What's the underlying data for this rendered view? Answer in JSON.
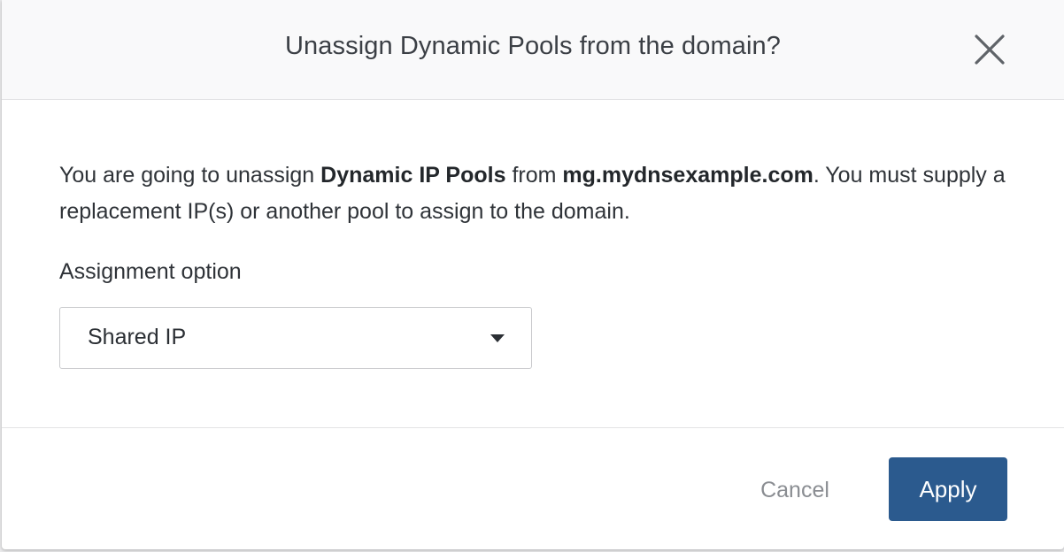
{
  "dialog": {
    "title": "Unassign Dynamic Pools from the domain?",
    "close_icon": "close-icon",
    "description": {
      "part1": "You are going to unassign ",
      "pool_name": "Dynamic IP Pools",
      "part2": " from ",
      "domain": "mg.mydnsexample.com",
      "part3": ". You must supply a replacement IP(s) or another pool to assign to the domain."
    },
    "assignment": {
      "label": "Assignment option",
      "selected_value": "Shared IP",
      "caret_icon": "caret-down-icon"
    },
    "footer": {
      "cancel_label": "Cancel",
      "apply_label": "Apply"
    },
    "colors": {
      "primary": "#2b5a8e",
      "header_bg": "#f9f9fa",
      "muted_text": "#8a8d92"
    }
  }
}
